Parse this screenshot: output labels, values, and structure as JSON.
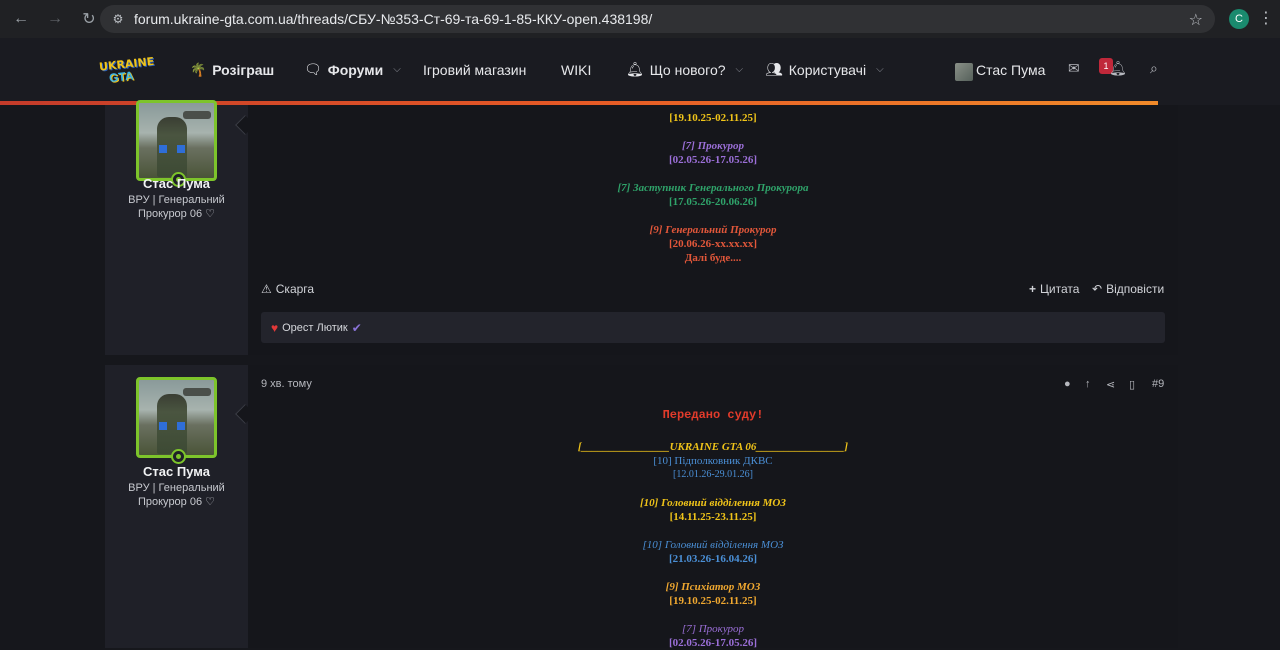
{
  "browser": {
    "url": "forum.ukraine-gta.com.ua/threads/СБУ-№353-Ст-69-та-69-1-85-ККУ-open.438198/",
    "profile_initial": "C"
  },
  "header": {
    "logo_top": "UKRAINE",
    "logo_bottom": "GTA",
    "nav": {
      "giveaway": "Розіграш",
      "forums": "Форуми",
      "shop": "Ігровий магазин",
      "wiki": "WIKI",
      "whats_new": "Що нового?",
      "users": "Користувачі"
    },
    "user_name": "Стас Пума",
    "alerts_count": "1"
  },
  "colors": {
    "accent_orange": "#e65a26",
    "online_green": "#7dc42b",
    "gold": "#f0c419",
    "purple": "#9b6fd8",
    "teal_green": "#2fa36a",
    "salmon": "#e2573a",
    "blue": "#4a8fd6",
    "red": "#e23b2b"
  },
  "post1": {
    "author": "Стас Пума",
    "title_line1": "ВРУ | Генеральний",
    "title_line2": "Прокурор 06 ♡",
    "lines": {
      "l1": "[19.10.25-02.11.25]",
      "l2": "[7] Прокурор",
      "l3": "[02.05.26-17.05.26]",
      "l4": "[7] Заступник Генерального Прокурора",
      "l5": "[17.05.26-20.06.26]",
      "l6": "[9] Генеральний Прокурор",
      "l7": "[20.06.26-xx.xx.xx]",
      "l8": "Далі буде...."
    },
    "report": "Скарга",
    "quote": "Цитата",
    "reply": "Відповісти",
    "reaction_user": "Орест Лютик"
  },
  "post2": {
    "time": "9 хв. тому",
    "number": "#9",
    "author": "Стас Пума",
    "title_line1": "ВРУ | Генеральний",
    "title_line2": "Прокурор 06 ♡",
    "lines": {
      "heading": "Передано суду!",
      "banner": "[________________UKRAINE GTA 06________________]",
      "l1": "[10] Підполковник ДКВС",
      "l2": "[12.01.26-29.01.26]",
      "l3": "[10] Головний відділення МОЗ",
      "l4": "[14.11.25-23.11.25]",
      "l5": "[10] Головний відділення МОЗ",
      "l6": "[21.03.26-16.04.26]",
      "l7": "[9] Психіатор МОЗ",
      "l8": "[19.10.25-02.11.25]",
      "l9": "[7] Прокурор",
      "l10": "[02.05.26-17.05.26]"
    }
  }
}
